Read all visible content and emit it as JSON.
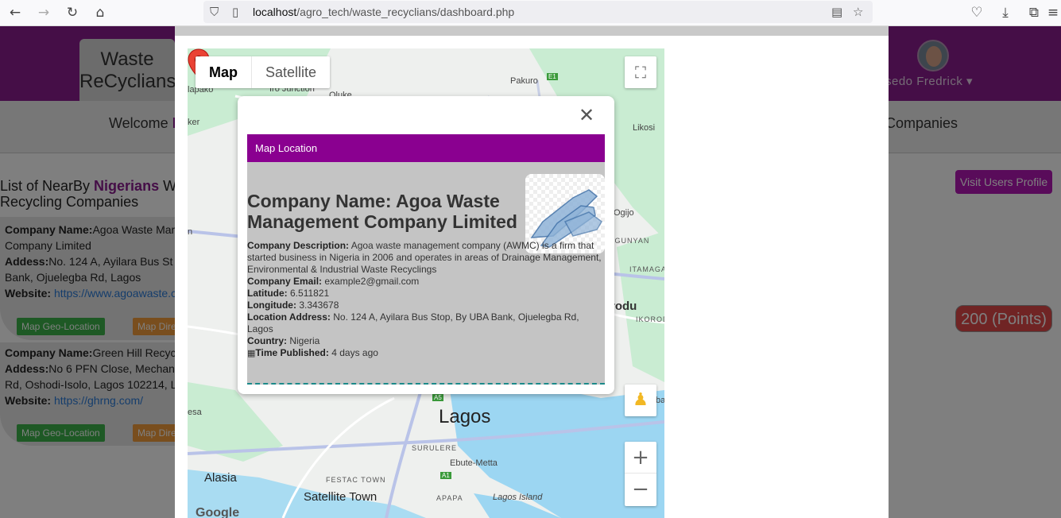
{
  "browser": {
    "url_host": "localhost",
    "url_path": "/agro_tech/waste_recyclians/dashboard.php"
  },
  "header": {
    "logo": "Waste ReCyclians",
    "user_name": "sedo Fredrick"
  },
  "nav": {
    "welcome": "Welcome",
    "welcome_name": "I",
    "companies": "Companies"
  },
  "list": {
    "title_prefix": "List of NearBy ",
    "title_highlight": "Nigerians",
    "title_suffix": " W",
    "title_line2": "Recycling Companies",
    "items": [
      {
        "name_label": "Company Name:",
        "name_value": "Agoa Waste Mar",
        "name_line2": "Company Limited",
        "address_label": "Addess:",
        "address_value": "No. 124 A, Ayilara Bus St",
        "address_line2": "Bank, Ojuelegba Rd, Lagos",
        "website_label": "Website:",
        "website_value": "https://www.agoawaste.c",
        "geo_btn": "Map Geo-Location",
        "dir_btn": "Map Dire"
      },
      {
        "name_label": "Company Name:",
        "name_value": "Green Hill Recyc",
        "address_label": "Addess:",
        "address_value": "No 6 PFN Close, Mechan",
        "address_line2": "Rd, Oshodi-Isolo, Lagos 102214, L",
        "website_label": "Website:",
        "website_value": "https://ghrng.com/",
        "geo_btn": "Map Geo-Location",
        "dir_btn": "Map Dire"
      }
    ]
  },
  "right": {
    "visit_btn": "Visit Users Profile",
    "points": "200 (Points)"
  },
  "map": {
    "types": [
      "Map",
      "Satellite"
    ],
    "labels": {
      "pakuro": "Pakuro",
      "apako": "lapako",
      "iro": "Iro Junction",
      "oluke": "Oluke",
      "ker": "ker",
      "likosi": "Likosi",
      "ogijo": "Ogijo",
      "ongunyan": "ONGUNYAN",
      "itamaga": "ITAMAGA",
      "rodu": "rodu",
      "ikorod": "IKOROD",
      "lagos": "Lagos",
      "surulere": "SURULERE",
      "ebute": "Ebute-Metta",
      "alasia": "Alasia",
      "festac": "FESTAC TOWN",
      "satellite_town": "Satellite Town",
      "apapa": "APAPA",
      "lagos_island": "Lagos Island",
      "esa": "esa",
      "ba": "ba",
      "n": "n",
      "e1": "E1",
      "a5": "A5",
      "a1": "A1",
      "google": "Google"
    }
  },
  "info": {
    "head": "Map Location",
    "title_label": "Company Name:",
    "title_value": " Agoa Waste Management Company Limited",
    "desc_label": "Company Description:",
    "desc_value": " Agoa waste management company (AWMC) is a firm that started business in Nigeria in 2006 and operates in areas of Drainage Management, Environmental & Industrial Waste Recyclings",
    "email_label": "Company Email:",
    "email_value": " example2@gmail.com",
    "lat_label": "Latitude:",
    "lat_value": " 6.511821",
    "lng_label": "Longitude:",
    "lng_value": " 3.343678",
    "addr_label": "Location Address:",
    "addr_value": " No. 124 A, Ayilara Bus Stop, By UBA Bank, Ojuelegba Rd, Lagos",
    "country_label": "Country:",
    "country_value": " Nigeria",
    "time_label": "Time Published:",
    "time_value": " 4 days ago"
  }
}
